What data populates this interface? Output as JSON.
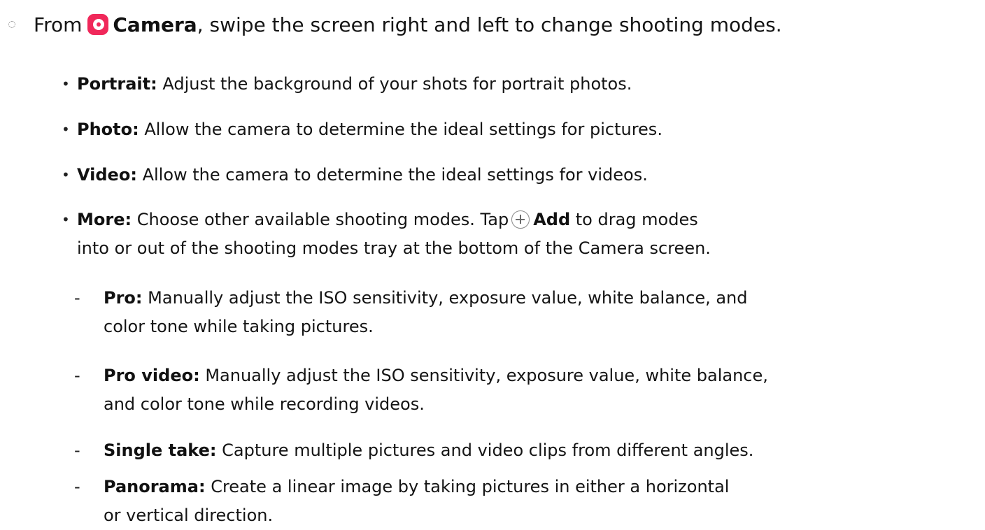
{
  "step": {
    "prefix": "From",
    "app_name": "Camera",
    "rest": ", swipe the screen right and left to change shooting modes."
  },
  "icons": {
    "camera_app": "camera-app-icon",
    "add": "add-circle-icon"
  },
  "colors": {
    "camera_icon": "#f0285a",
    "text": "#141414"
  },
  "bullet_marker": "•",
  "dash_marker": "-",
  "modes": [
    {
      "term": "Portrait:",
      "desc": "Adjust the background of your shots for portrait photos."
    },
    {
      "term": "Photo:",
      "desc": "Allow the camera to determine the ideal settings for pictures."
    },
    {
      "term": "Video:",
      "desc": "Allow the camera to determine the ideal settings for videos."
    },
    {
      "term": "More:",
      "desc_before_icon": "Choose other available shooting modes. Tap",
      "icon_label": "Add",
      "desc_after_icon": "to drag modes",
      "desc_line2": "into or out of the shooting modes tray at the bottom of the Camera screen."
    }
  ],
  "more_modes": [
    {
      "term": "Pro:",
      "line1": "Manually adjust the ISO sensitivity, exposure value, white balance, and",
      "line2": "color tone while taking pictures."
    },
    {
      "term": "Pro video:",
      "line1": "Manually adjust the ISO sensitivity, exposure value, white balance,",
      "line2": "and color tone while recording videos."
    },
    {
      "term": "Single take:",
      "line1": "Capture multiple pictures and video clips from different angles."
    },
    {
      "term": "Panorama:",
      "line1": "Create a linear image by taking pictures in either a horizontal",
      "line2": "or vertical direction."
    }
  ]
}
